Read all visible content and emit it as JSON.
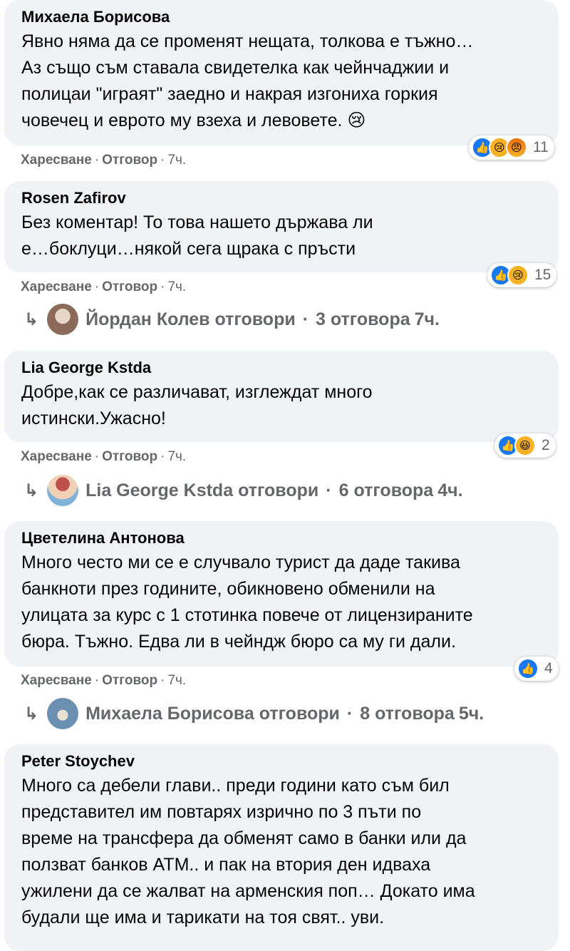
{
  "comments": [
    {
      "author": "Михаела Борисова",
      "lines": [
        "Явно няма да се променят нещата, толкова е тъжно…",
        "Аз също съм ставала свидетелка как чейнчаджии и",
        "полицаи \"играят\" заедно и накрая изгониха горкия",
        "човечец и еврото му взеха и левовете. 😢"
      ],
      "like": "Харесване",
      "reply": "Отговор",
      "time": "7ч.",
      "reactions": [
        "like-icon",
        "sad-icon",
        "angry-icon"
      ],
      "reaction_count": "11"
    },
    {
      "author": "Rosen Zafirov",
      "lines": [
        "Без коментар! То това нашето държава ли",
        "е…боклуци…някой сега щрака с пръсти"
      ],
      "like": "Харесване",
      "reply": "Отговор",
      "time": "7ч.",
      "reactions": [
        "like-icon",
        "sad-icon"
      ],
      "reaction_count": "15",
      "replies": {
        "name": "Йордан Колев",
        "verb": "отговори",
        "count": "3 отговора",
        "time": "7ч.",
        "avatar_color": "#8b6a5a"
      }
    },
    {
      "author": "Lia George Kstda",
      "lines": [
        "Добре,как се различават, изглеждат много",
        "истински.Ужасно!"
      ],
      "like": "Харесване",
      "reply": "Отговор",
      "time": "7ч.",
      "reactions": [
        "like-icon",
        "haha-icon"
      ],
      "reaction_count": "2",
      "replies": {
        "name": "Lia George Kstda",
        "verb": "отговори",
        "count": "6 отговора",
        "time": "4ч.",
        "avatar_color": "#c0504d"
      }
    },
    {
      "author": "Цветелина Антонова",
      "lines": [
        "Много често ми се е случвало турист да даде такива",
        "банкноти през годините, обикновено обменили на",
        "улицата за курс с 1 стотинка повече от лицензираните",
        "бюра. Тъжно. Едва ли в чейндж бюро са му ги дали."
      ],
      "like": "Харесване",
      "reply": "Отговор",
      "time": "7ч.",
      "reactions": [
        "like-icon"
      ],
      "reaction_count": "4",
      "replies": {
        "name": "Михаела Борисова",
        "verb": "отговори",
        "count": "8 отговора",
        "time": "5ч.",
        "avatar_color": "#6a8fb0"
      }
    },
    {
      "author": "Peter Stoychev",
      "lines": [
        "Много са дебели глави.. преди години като съм бил",
        "представител им повтарях изрично по 3 пъти по",
        "време на трансфера да обменят само в банки или да",
        "ползват банков ATM.. и пак на втория ден идваха",
        "ужилени да се жалват на арменския поп… Докато има",
        "будали ще има и тарикати на тоя свят.. уви."
      ]
    }
  ],
  "separators": {
    "dot": "·",
    "reply_arrow": "↳"
  },
  "colors": {
    "bubble": "#f0f2f5",
    "like": "#1877f2",
    "meta": "#65676b"
  }
}
